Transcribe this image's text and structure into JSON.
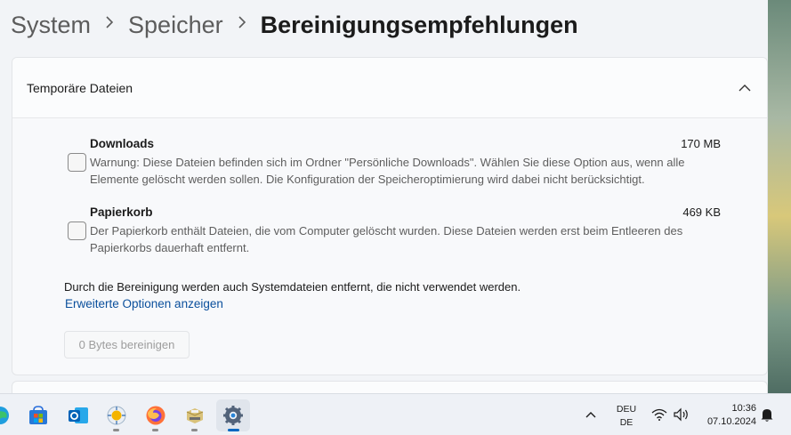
{
  "breadcrumb": {
    "items": [
      "System",
      "Speicher",
      "Bereinigungsempfehlungen"
    ],
    "separator_icon": "chevron-right-icon"
  },
  "card": {
    "title": "Temporäre Dateien",
    "expanded": true,
    "items": [
      {
        "name": "Downloads",
        "size": "170 MB",
        "checked": false,
        "description": "Warnung: Diese Dateien befinden sich im Ordner \"Persönliche Downloads\". Wählen Sie diese Option aus, wenn alle Elemente gelöscht werden sollen. Die Konfiguration der Speicheroptimierung wird dabei nicht berücksichtigt."
      },
      {
        "name": "Papierkorb",
        "size": "469 KB",
        "checked": false,
        "description": "Der Papierkorb enthält Dateien, die vom Computer gelöscht wurden. Diese Dateien werden erst beim Entleeren des Papierkorbs dauerhaft entfernt."
      }
    ],
    "info_text": "Durch die Bereinigung werden auch Systemdateien entfernt, die nicht verwendet werden.",
    "advanced_link": "Erweiterte Optionen anzeigen",
    "clean_button": "0 Bytes bereinigen",
    "clean_button_enabled": false
  },
  "taskbar": {
    "apps": [
      "edge-icon",
      "store-icon",
      "outlook-icon",
      "weather-icon",
      "firefox-icon",
      "file-manager-icon",
      "settings-icon"
    ],
    "active_app": "settings-icon",
    "language": {
      "line1": "DEU",
      "line2": "DE"
    },
    "clock": {
      "time": "10:36",
      "date": "07.10.2024"
    }
  },
  "colors": {
    "accent": "#0067c0",
    "link": "#0a4f9c"
  }
}
